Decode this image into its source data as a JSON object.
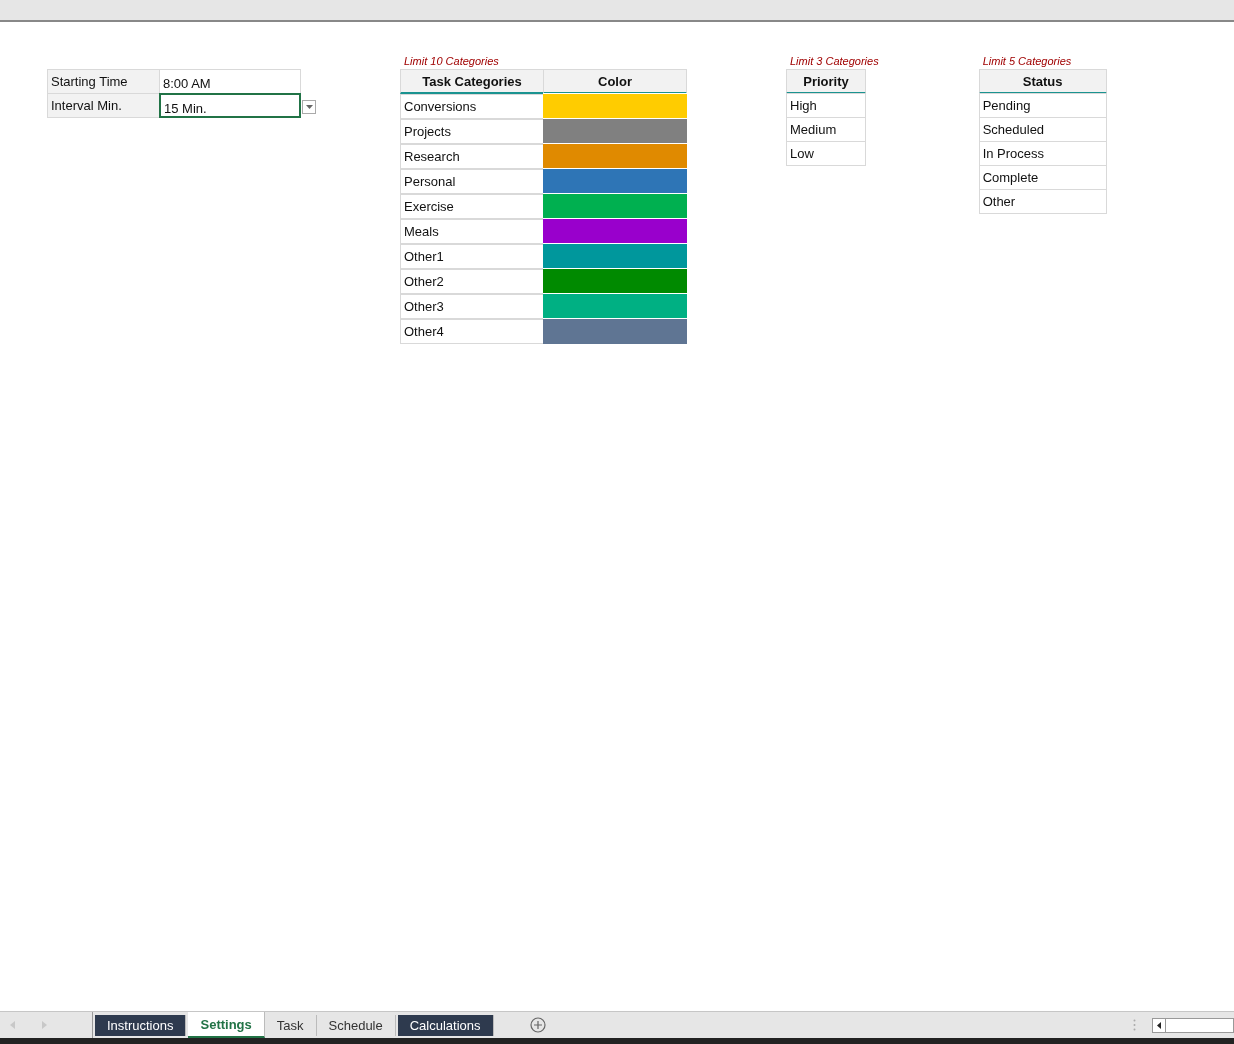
{
  "settings": [
    {
      "label": "Starting Time",
      "value": "8:00 AM",
      "selected": false
    },
    {
      "label": "Interval Min.",
      "value": "15 Min.",
      "selected": true
    }
  ],
  "task_categories": {
    "note": "Limit 10 Categories",
    "columns": [
      "Task Categories",
      "Color"
    ],
    "rows": [
      {
        "name": "Conversions",
        "color": "#ffcc00"
      },
      {
        "name": "Projects",
        "color": "#808080"
      },
      {
        "name": "Research",
        "color": "#e08a00"
      },
      {
        "name": "Personal",
        "color": "#2e75b6"
      },
      {
        "name": "Exercise",
        "color": "#00b050"
      },
      {
        "name": "Meals",
        "color": "#9900cc"
      },
      {
        "name": "Other1",
        "color": "#00979c"
      },
      {
        "name": "Other2",
        "color": "#008a00"
      },
      {
        "name": "Other3",
        "color": "#00b083"
      },
      {
        "name": "Other4",
        "color": "#5f7593"
      }
    ]
  },
  "priority": {
    "note": "Limit 3 Categories",
    "column": "Priority",
    "rows": [
      "High",
      "Medium",
      "Low"
    ]
  },
  "status": {
    "note": "Limit 5 Categories",
    "column": "Status",
    "rows": [
      "Pending",
      "Scheduled",
      "In Process",
      "Complete",
      "Other"
    ]
  },
  "sheet_tabs": [
    {
      "label": "Instructions",
      "selected": false,
      "color": "#2e3a4e"
    },
    {
      "label": "Settings",
      "selected": true
    },
    {
      "label": "Task",
      "selected": false
    },
    {
      "label": "Schedule",
      "selected": false
    },
    {
      "label": "Calculations",
      "selected": false,
      "color": "#2e3a4e"
    }
  ]
}
